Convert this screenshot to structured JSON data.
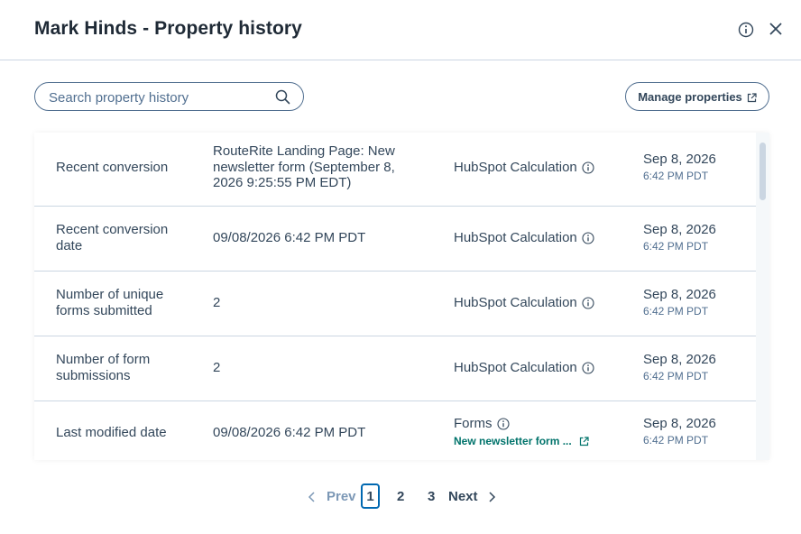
{
  "modal": {
    "title": "Mark Hinds - Property history",
    "info_icon": "info-icon",
    "close_icon": "close-icon"
  },
  "search": {
    "placeholder": "Search property history",
    "value": "",
    "icon": "search-icon"
  },
  "manage_button": {
    "label": "Manage properties",
    "icon": "external-link-icon"
  },
  "rows": [
    {
      "name": "Recent conversion",
      "value": "RouteRite Landing Page: New newsletter form (September 8, 2026 9:25:55 PM EDT)",
      "source": "HubSpot Calculation",
      "date": "Sep 8, 2026",
      "time": "6:42 PM PDT"
    },
    {
      "name": "Recent conversion date",
      "value": "09/08/2026 6:42 PM PDT",
      "source": "HubSpot Calculation",
      "date": "Sep 8, 2026",
      "time": "6:42 PM PDT"
    },
    {
      "name": "Number of unique forms submitted",
      "value": "2",
      "source": "HubSpot Calculation",
      "date": "Sep 8, 2026",
      "time": "6:42 PM PDT"
    },
    {
      "name": "Number of form submissions",
      "value": "2",
      "source": "HubSpot Calculation",
      "date": "Sep 8, 2026",
      "time": "6:42 PM PDT"
    },
    {
      "name": "Last modified date",
      "value": "09/08/2026 6:42 PM PDT",
      "source": "Forms",
      "source_link": "New newsletter form ...",
      "date": "Sep 8, 2026",
      "time": "6:42 PM PDT"
    }
  ],
  "pagination": {
    "prev": "Prev",
    "pages": [
      "1",
      "2",
      "3"
    ],
    "current": "1",
    "next": "Next"
  },
  "colors": {
    "text": "#33475b",
    "border": "#cbd6e2",
    "link": "#00736b",
    "active_page": "#0068b1"
  }
}
